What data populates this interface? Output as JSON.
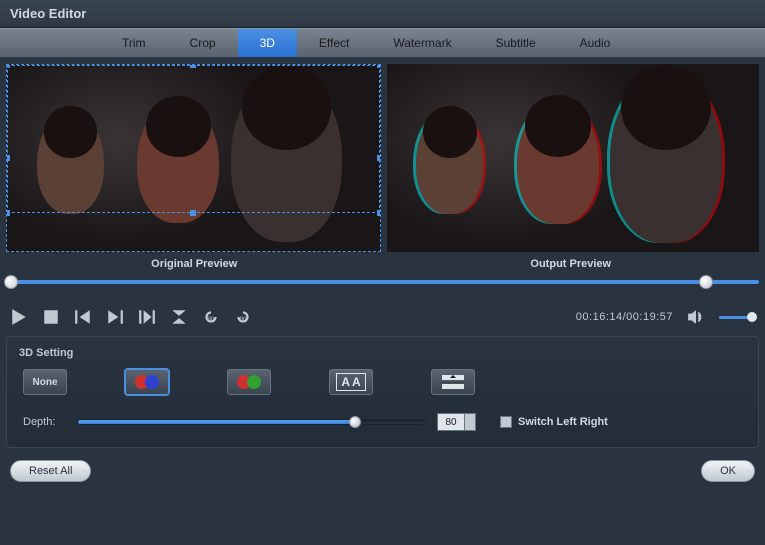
{
  "title": "Video Editor",
  "tabs": [
    "Trim",
    "Crop",
    "3D",
    "Effect",
    "Watermark",
    "Subtitle",
    "Audio"
  ],
  "active_tab_index": 2,
  "previews": {
    "original": "Original Preview",
    "output": "Output Preview"
  },
  "timecode": "00:16:14/00:19:57",
  "settings": {
    "title": "3D Setting",
    "modes": {
      "none": "None"
    },
    "depth_label": "Depth:",
    "depth_value": "80",
    "switch_lr": "Switch Left Right"
  },
  "buttons": {
    "reset": "Reset All",
    "ok": "OK"
  },
  "timeline": {
    "thumb2_pct": 92
  },
  "slider": {
    "fill_pct": 80
  }
}
